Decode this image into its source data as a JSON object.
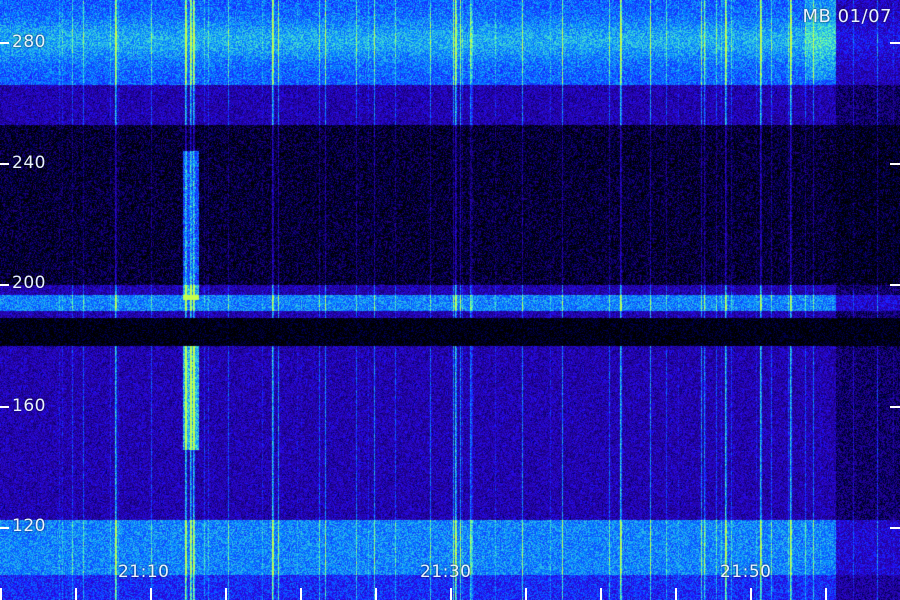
{
  "stamp": "MB 01/07",
  "y_axis": {
    "labels": [
      "280",
      "240",
      "200",
      "160",
      "120"
    ]
  },
  "x_axis": {
    "labels": [
      "21:10",
      "21:30",
      "21:50"
    ]
  },
  "colors": {
    "background": "#000000",
    "low": "#1b0f6e",
    "mid": "#1f3fff",
    "high": "#18d6ff",
    "peak": "#7dff6a",
    "text": "#e9f3ff"
  }
}
